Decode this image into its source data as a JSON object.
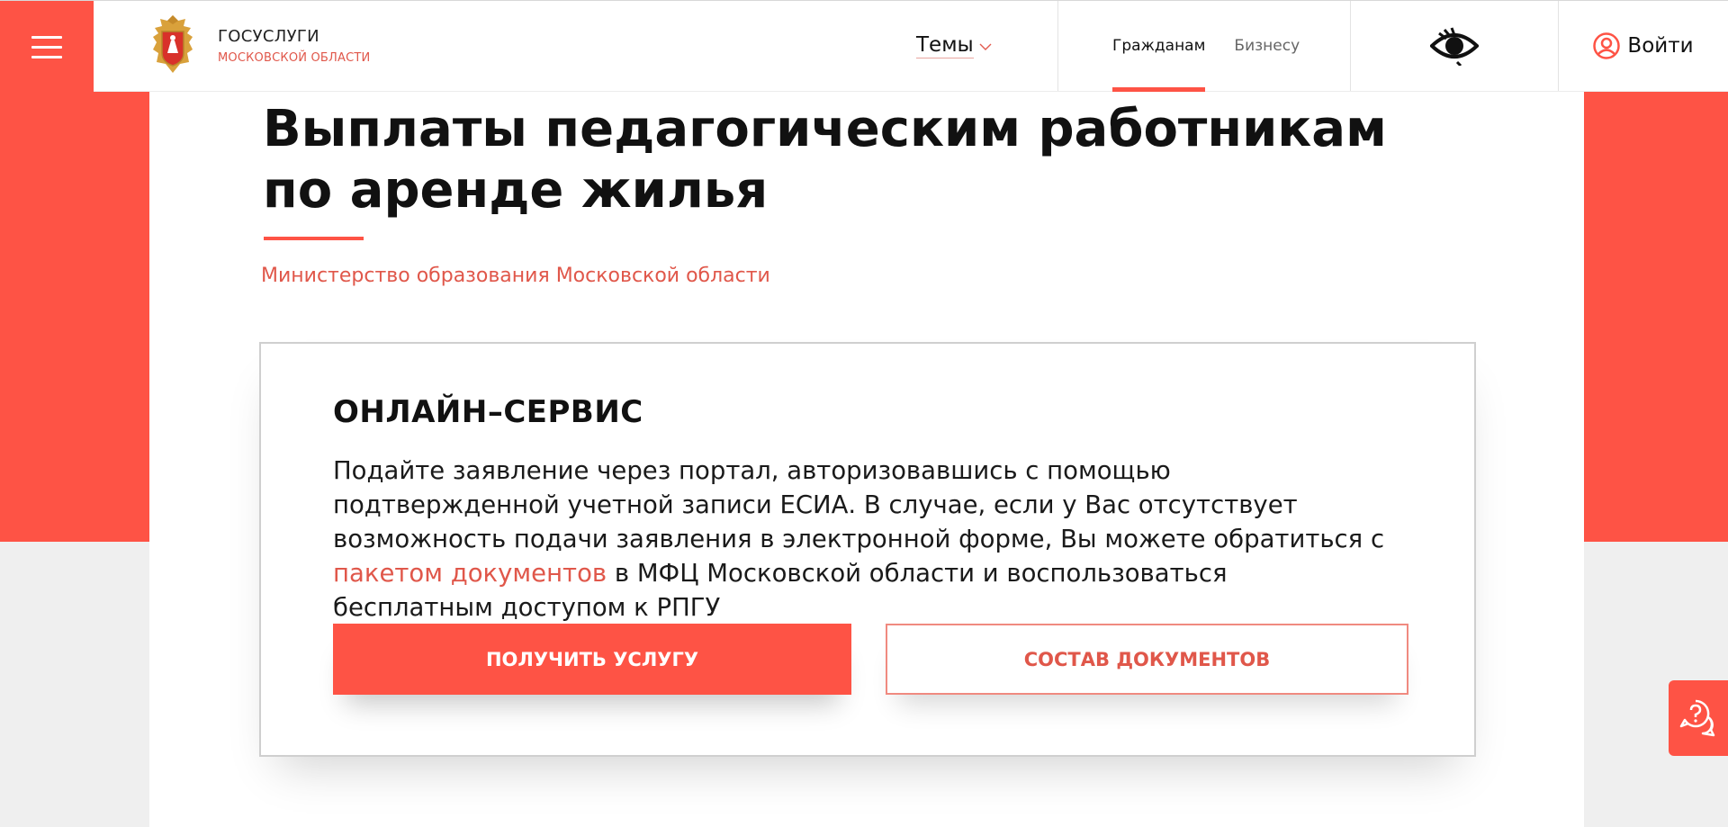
{
  "header": {
    "logo_title": "ГОСУСЛУГИ",
    "logo_subtitle": "МОСКОВСКОЙ ОБЛАСТИ",
    "topics_label": "Темы",
    "audience": [
      "Гражданам",
      "Бизнесу"
    ],
    "login_label": "Войти",
    "icons": {
      "menu": "hamburger-menu-icon",
      "logo": "moscow-region-coat-of-arms",
      "topics": "chevron-down-icon",
      "accessibility": "eye-icon",
      "user": "user-icon"
    }
  },
  "page": {
    "title": "Выплаты педагогическим работникам по аренде жилья",
    "ministry": "Министерство образования Московской области"
  },
  "service_card": {
    "heading": "ОНЛАЙН–СЕРВИС",
    "text_before_link": "Подайте заявление через портал, авторизовавшись с помощью подтвержденной учетной записи ЕСИА. В случае, если у Вас отсутствует возможность подачи заявления в электронной форме, Вы можете обратиться с ",
    "link_text": "пакетом документов",
    "text_after_link": " в МФЦ Московской области и воспользоваться бесплатным доступом к РПГУ",
    "primary_button": "ПОЛУЧИТЬ УСЛУГУ",
    "secondary_button": "СОСТАВ ДОКУМЕНТОВ"
  },
  "help": {
    "icon": "help-chat-icon"
  },
  "colors": {
    "accent": "#fe5345",
    "accent_text": "#e0574a",
    "background": "#efefef"
  }
}
